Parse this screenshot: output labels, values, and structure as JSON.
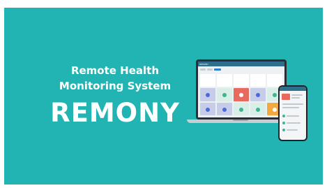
{
  "headline": {
    "line1": "Remote Health",
    "line2": "Monitoring System",
    "brand": "REMONY"
  },
  "colors": {
    "background": "#22b4b2",
    "text": "#ffffff",
    "alert": "#e86a5e",
    "ok": "#3fb58f"
  },
  "laptop": {
    "app_label": "REMONY"
  }
}
